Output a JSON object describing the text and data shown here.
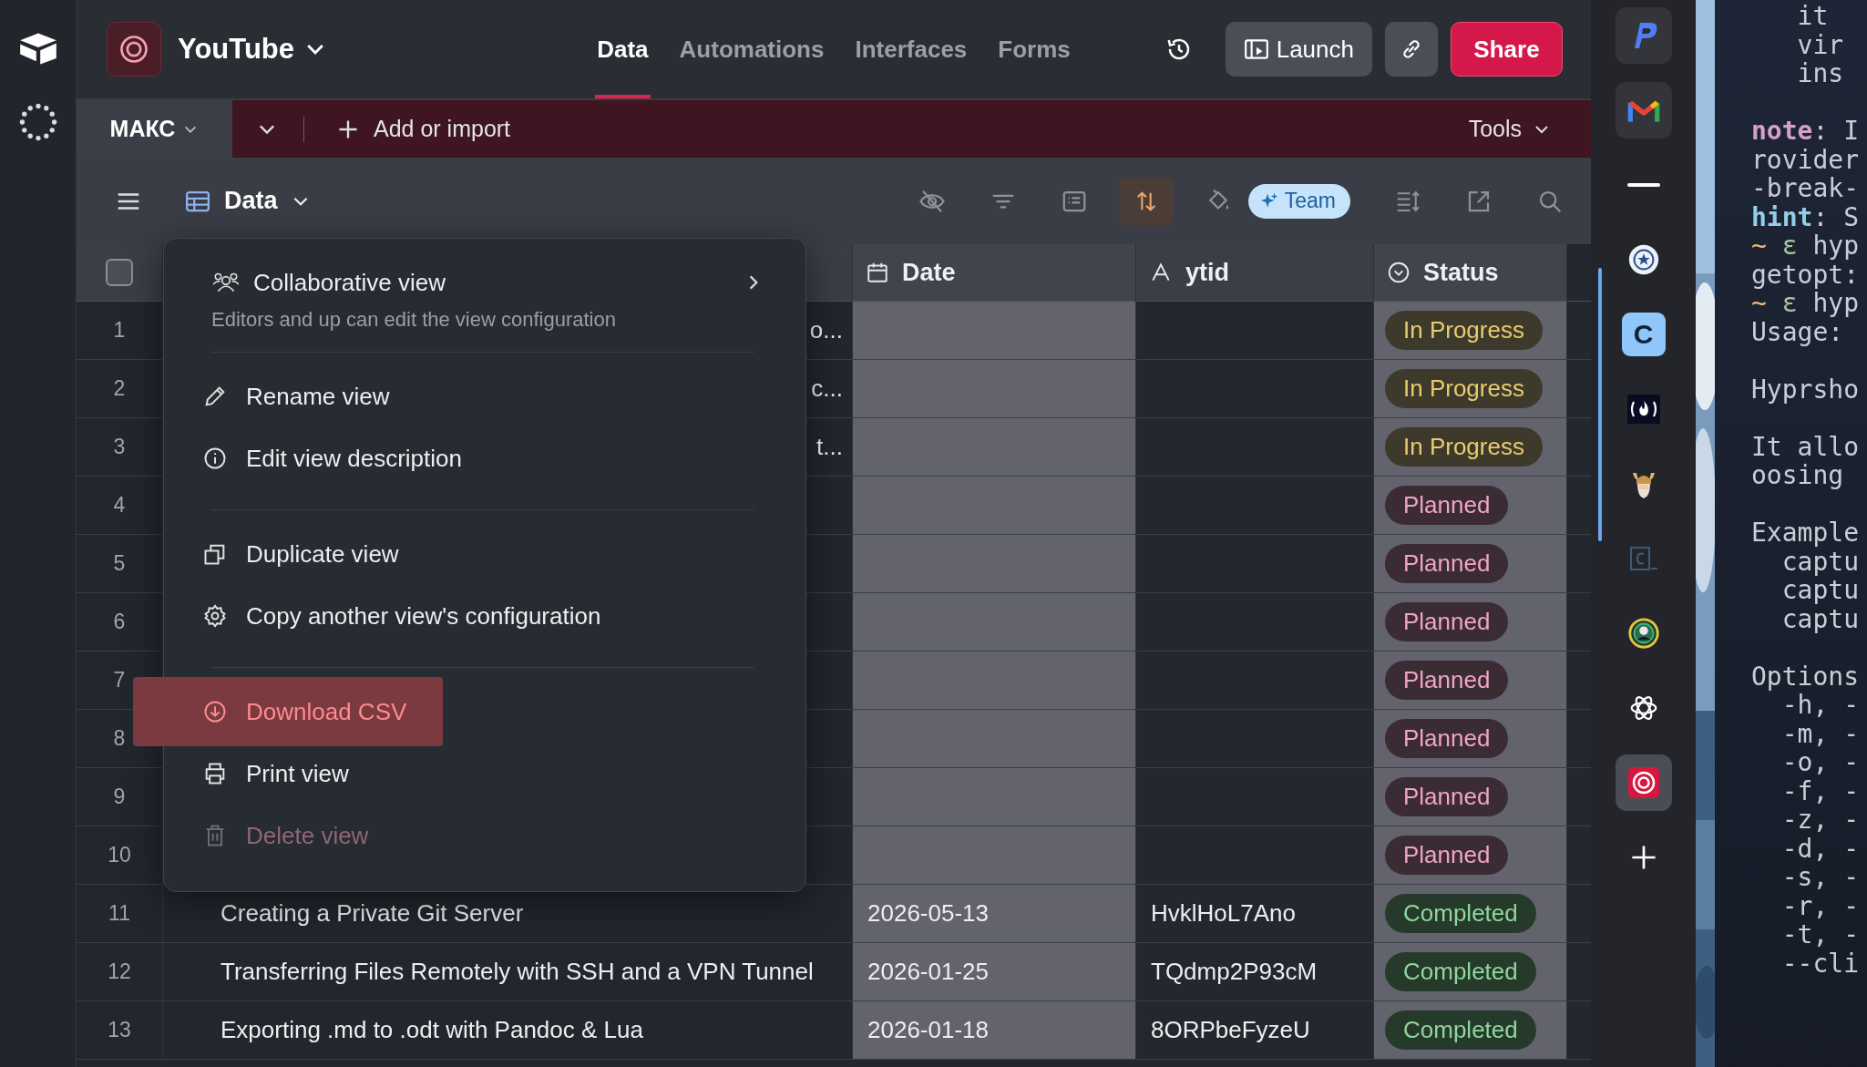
{
  "app": {
    "base_name": "YouTube",
    "tabs": [
      {
        "label": "Data",
        "selected": true
      },
      {
        "label": "Automations",
        "selected": false
      },
      {
        "label": "Interfaces",
        "selected": false
      },
      {
        "label": "Forms",
        "selected": false
      }
    ],
    "launch": "Launch",
    "share": "Share"
  },
  "tablebar": {
    "tables": [
      {
        "label": "МАКС",
        "selected": true
      }
    ],
    "add": "Add or import",
    "tools": "Tools"
  },
  "viewbar": {
    "view": "Data",
    "team": "Team",
    "sort_active": true
  },
  "table": {
    "select_all": {
      "checked": false
    },
    "columns": [
      {
        "label": "Date",
        "highlighted": true,
        "kind": "date"
      },
      {
        "label": "ytid",
        "highlighted": false,
        "kind": "text"
      },
      {
        "label": "Status",
        "highlighted": true,
        "kind": "status"
      }
    ],
    "rows": [
      {
        "number": "1",
        "title_tail": "o...",
        "status": {
          "label": "In Progress",
          "kind": "in-progress"
        }
      },
      {
        "number": "2",
        "title_tail": "c...",
        "status": {
          "label": "In Progress",
          "kind": "in-progress"
        }
      },
      {
        "number": "3",
        "title_tail": "t...",
        "status": {
          "label": "In Progress",
          "kind": "in-progress"
        }
      },
      {
        "number": "4",
        "status": {
          "label": "Planned",
          "kind": "planned"
        }
      },
      {
        "number": "5",
        "status": {
          "label": "Planned",
          "kind": "planned"
        }
      },
      {
        "number": "6",
        "status": {
          "label": "Planned",
          "kind": "planned"
        }
      },
      {
        "number": "7",
        "status": {
          "label": "Planned",
          "kind": "planned"
        }
      },
      {
        "number": "8",
        "status": {
          "label": "Planned",
          "kind": "planned"
        }
      },
      {
        "number": "9",
        "status": {
          "label": "Planned",
          "kind": "planned"
        }
      },
      {
        "number": "10",
        "status": {
          "label": "Planned",
          "kind": "planned"
        }
      },
      {
        "number": "11",
        "title": "Creating a Private Git Server",
        "date": "2026-05-13",
        "ytid": "HvklHoL7Ano",
        "status": {
          "label": "Completed",
          "kind": "completed"
        }
      },
      {
        "number": "12",
        "title": "Transferring Files Remotely with SSH and a VPN Tunnel",
        "date": "2026-01-25",
        "ytid": "TQdmp2P93cM",
        "status": {
          "label": "Completed",
          "kind": "completed"
        }
      },
      {
        "number": "13",
        "title": "Exporting .md to .odt with Pandoc & Lua",
        "date": "2026-01-18",
        "ytid": "8ORPbeFyzeU",
        "status": {
          "label": "Completed",
          "kind": "completed"
        }
      }
    ]
  },
  "menu": {
    "header": {
      "label": "Collaborative view",
      "description": "Editors and up can edit the view configuration"
    },
    "sections": [
      [
        {
          "label": "Rename view",
          "highlighted": false,
          "disabled": false
        },
        {
          "label": "Edit view description",
          "highlighted": false,
          "disabled": false
        }
      ],
      [
        {
          "label": "Duplicate view",
          "highlighted": false,
          "disabled": false
        },
        {
          "label": "Copy another view's configuration",
          "highlighted": false,
          "disabled": false
        }
      ],
      [
        {
          "label": "Download CSV",
          "highlighted": true,
          "disabled": false
        },
        {
          "label": "Print view",
          "highlighted": false,
          "disabled": false
        },
        {
          "label": "Delete view",
          "highlighted": false,
          "disabled": true
        }
      ]
    ]
  },
  "dock": {
    "items": [
      {
        "kind": "p-logo",
        "tile": true,
        "selected": false
      },
      {
        "kind": "mail",
        "tile": true,
        "selected": false
      },
      {
        "kind": "bar",
        "tile": false,
        "selected": false
      },
      {
        "kind": "seal",
        "tile": false,
        "selected": false
      },
      {
        "kind": "letter-tile",
        "letter": "C",
        "tile": false,
        "selected": false
      },
      {
        "kind": "flame",
        "tile": false,
        "selected": false
      },
      {
        "kind": "viking",
        "tile": false,
        "selected": false
      },
      {
        "kind": "terminal",
        "tile": false,
        "selected": false
      },
      {
        "kind": "ring",
        "tile": false,
        "selected": false
      },
      {
        "kind": "knot",
        "tile": false,
        "selected": false
      },
      {
        "kind": "target",
        "tile": false,
        "selected": true
      },
      {
        "kind": "plus",
        "tile": false,
        "selected": false
      }
    ]
  },
  "terminal": {
    "lines": [
      {
        "parts": [
          {
            "kind": "plain",
            "text": "   it"
          }
        ]
      },
      {
        "parts": [
          {
            "kind": "plain",
            "text": "   vir"
          }
        ]
      },
      {
        "parts": [
          {
            "kind": "plain",
            "text": "   ins"
          }
        ]
      },
      {
        "space_before": true,
        "parts": [
          {
            "kind": "note",
            "text": "note"
          },
          {
            "kind": "plain",
            "text": ": I"
          }
        ]
      },
      {
        "parts": [
          {
            "kind": "plain",
            "text": "rovider"
          }
        ]
      },
      {
        "parts": [
          {
            "kind": "plain",
            "text": "-break-"
          }
        ]
      },
      {
        "parts": [
          {
            "kind": "hint",
            "text": "hint"
          },
          {
            "kind": "plain",
            "text": ": S"
          }
        ]
      },
      {
        "parts": [
          {
            "kind": "prompt",
            "text": "~"
          },
          {
            "kind": "epsilon",
            "text": " ε"
          },
          {
            "kind": "plain",
            "text": " hyp"
          }
        ]
      },
      {
        "parts": [
          {
            "kind": "plain",
            "text": "getopt:"
          }
        ]
      },
      {
        "parts": [
          {
            "kind": "prompt",
            "text": "~"
          },
          {
            "kind": "epsilon",
            "text": " ε"
          },
          {
            "kind": "plain",
            "text": " hyp"
          }
        ]
      },
      {
        "parts": [
          {
            "kind": "plain",
            "text": "Usage:"
          }
        ]
      },
      {
        "space_before": true,
        "parts": [
          {
            "kind": "plain",
            "text": "Hyprsho"
          }
        ]
      },
      {
        "space_before": true,
        "parts": [
          {
            "kind": "plain",
            "text": "It allo"
          }
        ]
      },
      {
        "parts": [
          {
            "kind": "plain",
            "text": "oosing"
          }
        ]
      },
      {
        "space_before": true,
        "parts": [
          {
            "kind": "plain",
            "text": "Example"
          }
        ]
      },
      {
        "parts": [
          {
            "kind": "plain",
            "text": "  captu"
          }
        ]
      },
      {
        "parts": [
          {
            "kind": "plain",
            "text": "  captu"
          }
        ]
      },
      {
        "parts": [
          {
            "kind": "plain",
            "text": "  captu"
          }
        ]
      },
      {
        "space_before": true,
        "parts": [
          {
            "kind": "plain",
            "text": "Options"
          }
        ]
      },
      {
        "parts": [
          {
            "kind": "plain",
            "text": "  -h, -"
          }
        ]
      },
      {
        "parts": [
          {
            "kind": "plain",
            "text": "  -m, -"
          }
        ]
      },
      {
        "parts": [
          {
            "kind": "plain",
            "text": "  -o, -"
          }
        ]
      },
      {
        "parts": [
          {
            "kind": "plain",
            "text": "  -f, -"
          }
        ]
      },
      {
        "parts": [
          {
            "kind": "plain",
            "text": "  -z, -"
          }
        ]
      },
      {
        "parts": [
          {
            "kind": "plain",
            "text": "  -d, -"
          }
        ]
      },
      {
        "parts": [
          {
            "kind": "plain",
            "text": "  -s, -"
          }
        ]
      },
      {
        "parts": [
          {
            "kind": "plain",
            "text": "  -r, -"
          }
        ]
      },
      {
        "parts": [
          {
            "kind": "plain",
            "text": "  -t, -"
          }
        ]
      },
      {
        "parts": [
          {
            "kind": "plain",
            "text": "  --cli"
          }
        ]
      }
    ]
  }
}
